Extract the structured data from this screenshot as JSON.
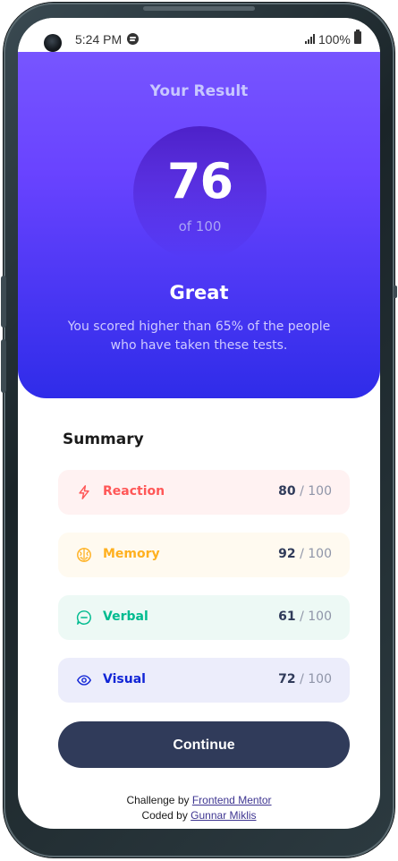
{
  "status_bar": {
    "time": "5:24 PM",
    "battery": "100%"
  },
  "result": {
    "heading": "Your Result",
    "score": "76",
    "score_max": "of 100",
    "rating": "Great",
    "description": "You scored higher than 65% of the people who have taken these tests."
  },
  "summary": {
    "title": "Summary",
    "items": [
      {
        "label": "Reaction",
        "score": "80",
        "max": " / 100",
        "icon": "lightning-icon",
        "color": "#ff5757",
        "bg": "#fff2f2"
      },
      {
        "label": "Memory",
        "score": "92",
        "max": " / 100",
        "icon": "brain-icon",
        "color": "#ffb01f",
        "bg": "#fffaf0"
      },
      {
        "label": "Verbal",
        "score": "61",
        "max": " / 100",
        "icon": "chat-icon",
        "color": "#00bb8f",
        "bg": "#edf9f5"
      },
      {
        "label": "Visual",
        "score": "72",
        "max": " / 100",
        "icon": "eye-icon",
        "color": "#1125d6",
        "bg": "#ecedfb"
      }
    ]
  },
  "continue_label": "Continue",
  "attribution": {
    "challenge_prefix": "Challenge by ",
    "challenge_link": "Frontend Mentor",
    "coded_prefix": "Coded by ",
    "coded_link": "Gunnar Miklis"
  }
}
